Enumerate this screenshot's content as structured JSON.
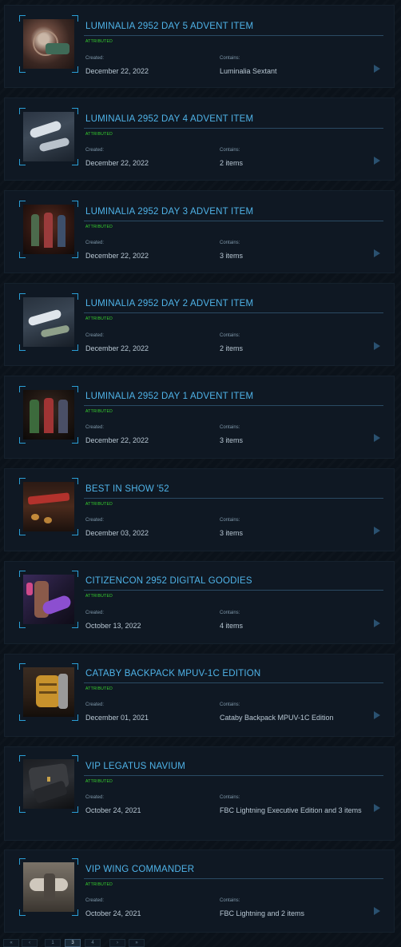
{
  "pledges": [
    {
      "title": "LUMINALIA 2952 DAY 5 ADVENT ITEM",
      "badge": "ATTRIBUTED",
      "created_label": "Created:",
      "created": "December 22, 2022",
      "contains_label": "Contains:",
      "contains": "Luminalia Sextant",
      "thumb_icon": "sextant-thumbnail"
    },
    {
      "title": "LUMINALIA 2952 DAY 4 ADVENT ITEM",
      "badge": "ATTRIBUTED",
      "created_label": "Created:",
      "created": "December 22, 2022",
      "contains_label": "Contains:",
      "contains": "2 items",
      "thumb_icon": "ship-thumbnail"
    },
    {
      "title": "LUMINALIA 2952 DAY 3 ADVENT ITEM",
      "badge": "ATTRIBUTED",
      "created_label": "Created:",
      "created": "December 22, 2022",
      "contains_label": "Contains:",
      "contains": "3 items",
      "thumb_icon": "characters-thumbnail"
    },
    {
      "title": "LUMINALIA 2952 DAY 2 ADVENT ITEM",
      "badge": "ATTRIBUTED",
      "created_label": "Created:",
      "created": "December 22, 2022",
      "contains_label": "Contains:",
      "contains": "2 items",
      "thumb_icon": "ship-thumbnail"
    },
    {
      "title": "LUMINALIA 2952 DAY 1 ADVENT ITEM",
      "badge": "ATTRIBUTED",
      "created_label": "Created:",
      "created": "December 22, 2022",
      "contains_label": "Contains:",
      "contains": "3 items",
      "thumb_icon": "characters-thumbnail"
    },
    {
      "title": "BEST IN SHOW '52",
      "badge": "ATTRIBUTED",
      "created_label": "Created:",
      "created": "December 03, 2022",
      "contains_label": "Contains:",
      "contains": "3 items",
      "thumb_icon": "table-thumbnail"
    },
    {
      "title": "CITIZENCON 2952 DIGITAL GOODIES",
      "badge": "ATTRIBUTED",
      "created_label": "Created:",
      "created": "October 13, 2022",
      "contains_label": "Contains:",
      "contains": "4 items",
      "thumb_icon": "armor-thumbnail"
    },
    {
      "title": "CATABY BACKPACK MPUV-1C EDITION",
      "badge": "ATTRIBUTED",
      "created_label": "Created:",
      "created": "December 01, 2021",
      "contains_label": "Contains:",
      "contains": "Cataby Backpack MPUV-1C Edition",
      "thumb_icon": "backpack-thumbnail"
    },
    {
      "title": "VIP LEGATUS NAVIUM",
      "badge": "ATTRIBUTED",
      "created_label": "Created:",
      "created": "October 24, 2021",
      "contains_label": "Contains:",
      "contains": "FBC Lightning Executive Edition and 3 items",
      "thumb_icon": "jacket-thumbnail"
    },
    {
      "title": "VIP WING COMMANDER",
      "badge": "ATTRIBUTED",
      "created_label": "Created:",
      "created": "October 24, 2021",
      "contains_label": "Contains:",
      "contains": "FBC Lightning and 2 items",
      "thumb_icon": "hangar-thumbnail"
    }
  ],
  "pagination": {
    "first": "«",
    "prev": "‹",
    "pages": [
      "1",
      "2",
      "3",
      "4",
      "5"
    ],
    "current": "3",
    "next": "›",
    "last": "»"
  },
  "colors": {
    "accent": "#4fb3e8",
    "badge": "#38d62f",
    "card_bg": "#0f1823",
    "page_bg": "#0b121a"
  }
}
